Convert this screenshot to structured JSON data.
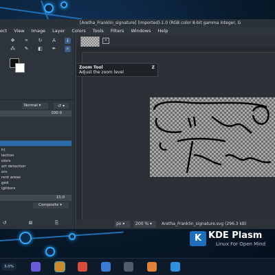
{
  "window": {
    "title": "[Aretha_Franklin_signature] (imported)-1.0 (RGB color 8-bit gamma integer, G"
  },
  "menu": [
    "ect",
    "View",
    "Image",
    "Layer",
    "Colors",
    "Tools",
    "Filters",
    "Windows",
    "Help"
  ],
  "tooltip": {
    "title": "Zoom Tool",
    "subtitle": "Adjust the zoom level",
    "shortcut": "Z"
  },
  "layers": {
    "mode": "Normal",
    "opacity": "100.0"
  },
  "select_list": [
    "h)",
    "lection",
    "olors",
    "art detection",
    "ors",
    "rent areas",
    "ged",
    "ighbors"
  ],
  "threshold": "15.0",
  "composite": "Composite",
  "status": {
    "unit": "px",
    "zoom": "200 %",
    "file": "Aretha_Franklin_signature.svg (296.3 kB)"
  },
  "desktop": {
    "brand": "KDE Plasm",
    "tagline": "Linux For Open Mind"
  },
  "taskbar": {
    "meter": "3.0%"
  },
  "colors": {
    "accent": "#2aa7ff",
    "selection": "#2d6aa8"
  }
}
